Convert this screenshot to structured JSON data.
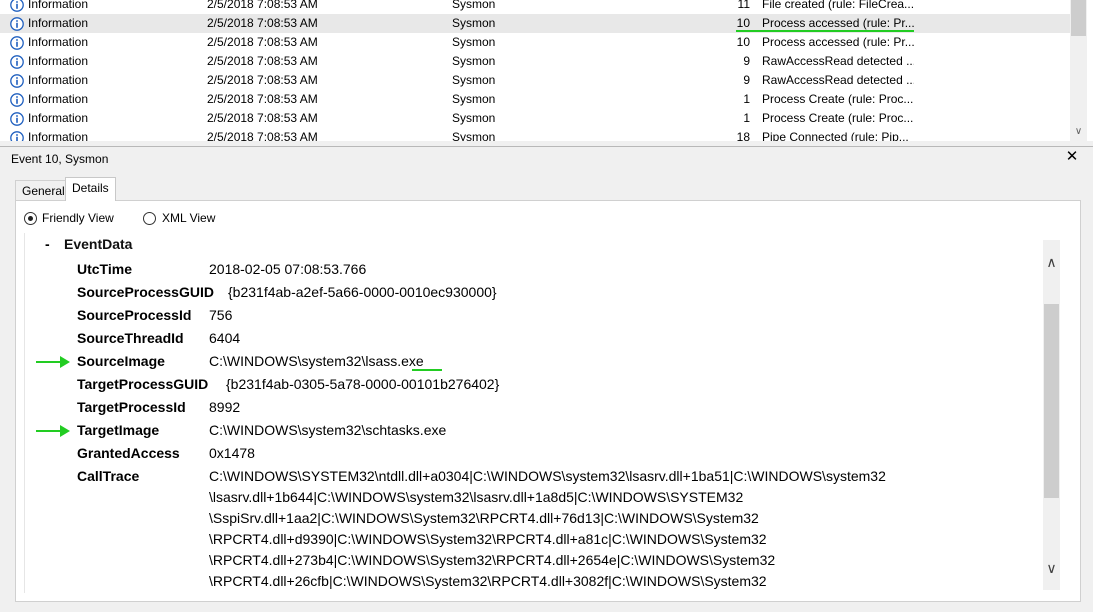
{
  "event_list": {
    "rows": [
      {
        "level": "Information",
        "date": "2/5/2018 7:08:53 AM",
        "source": "Sysmon",
        "event_id": "11",
        "task": "File created (rule: FileCrea..."
      },
      {
        "level": "Information",
        "date": "2/5/2018 7:08:53 AM",
        "source": "Sysmon",
        "event_id": "10",
        "task": "Process accessed (rule: Pr...",
        "selected": true
      },
      {
        "level": "Information",
        "date": "2/5/2018 7:08:53 AM",
        "source": "Sysmon",
        "event_id": "10",
        "task": "Process accessed (rule: Pr..."
      },
      {
        "level": "Information",
        "date": "2/5/2018 7:08:53 AM",
        "source": "Sysmon",
        "event_id": "9",
        "task": "RawAccessRead detected ..."
      },
      {
        "level": "Information",
        "date": "2/5/2018 7:08:53 AM",
        "source": "Sysmon",
        "event_id": "9",
        "task": "RawAccessRead detected ..."
      },
      {
        "level": "Information",
        "date": "2/5/2018 7:08:53 AM",
        "source": "Sysmon",
        "event_id": "1",
        "task": "Process Create (rule: Proc..."
      },
      {
        "level": "Information",
        "date": "2/5/2018 7:08:53 AM",
        "source": "Sysmon",
        "event_id": "1",
        "task": "Process Create (rule: Proc..."
      },
      {
        "level": "Information",
        "date": "2/5/2018 7:08:53 AM",
        "source": "Sysmon",
        "event_id": "18",
        "task": "Pipe Connected (rule: Pip..."
      }
    ]
  },
  "pane": {
    "title": "Event 10, Sysmon",
    "close_label": "✕",
    "tabs": {
      "general": "General",
      "details": "Details"
    },
    "view_options": {
      "friendly": "Friendly View",
      "xml": "XML View"
    }
  },
  "details": {
    "section_toggle": "-",
    "section_title": "EventData",
    "fields": {
      "utc_time": {
        "name": "UtcTime",
        "value": "2018-02-05 07:08:53.766"
      },
      "source_process_guid": {
        "name": "SourceProcessGUID",
        "value": "{b231f4ab-a2ef-5a66-0000-0010ec930000}"
      },
      "source_process_id": {
        "name": "SourceProcessId",
        "value": "756"
      },
      "source_thread_id": {
        "name": "SourceThreadId",
        "value": "6404"
      },
      "source_image": {
        "name": "SourceImage",
        "value": "C:\\WINDOWS\\system32\\lsass.exe"
      },
      "target_process_guid": {
        "name": "TargetProcessGUID",
        "value": "{b231f4ab-0305-5a78-0000-00101b276402}"
      },
      "target_process_id": {
        "name": "TargetProcessId",
        "value": "8992"
      },
      "target_image": {
        "name": "TargetImage",
        "value": "C:\\WINDOWS\\system32\\schtasks.exe"
      },
      "granted_access": {
        "name": "GrantedAccess",
        "value": "0x1478"
      },
      "call_trace": {
        "name": "CallTrace",
        "lines": [
          "C:\\WINDOWS\\SYSTEM32\\ntdll.dll+a0304|C:\\WINDOWS\\system32\\lsasrv.dll+1ba51|C:\\WINDOWS\\system32",
          "\\lsasrv.dll+1b644|C:\\WINDOWS\\system32\\lsasrv.dll+1a8d5|C:\\WINDOWS\\SYSTEM32",
          "\\SspiSrv.dll+1aa2|C:\\WINDOWS\\System32\\RPCRT4.dll+76d13|C:\\WINDOWS\\System32",
          "\\RPCRT4.dll+d9390|C:\\WINDOWS\\System32\\RPCRT4.dll+a81c|C:\\WINDOWS\\System32",
          "\\RPCRT4.dll+273b4|C:\\WINDOWS\\System32\\RPCRT4.dll+2654e|C:\\WINDOWS\\System32",
          "\\RPCRT4.dll+26cfb|C:\\WINDOWS\\System32\\RPCRT4.dll+3082f|C:\\WINDOWS\\System32"
        ]
      }
    }
  },
  "colors": {
    "highlight_green": "#22cc22",
    "info_icon_blue": "#1f5fbf",
    "selected_row": "#e8e8e8"
  },
  "icons": {
    "level_icon": "info-icon",
    "arrow_icon": "green-arrow-icon"
  }
}
